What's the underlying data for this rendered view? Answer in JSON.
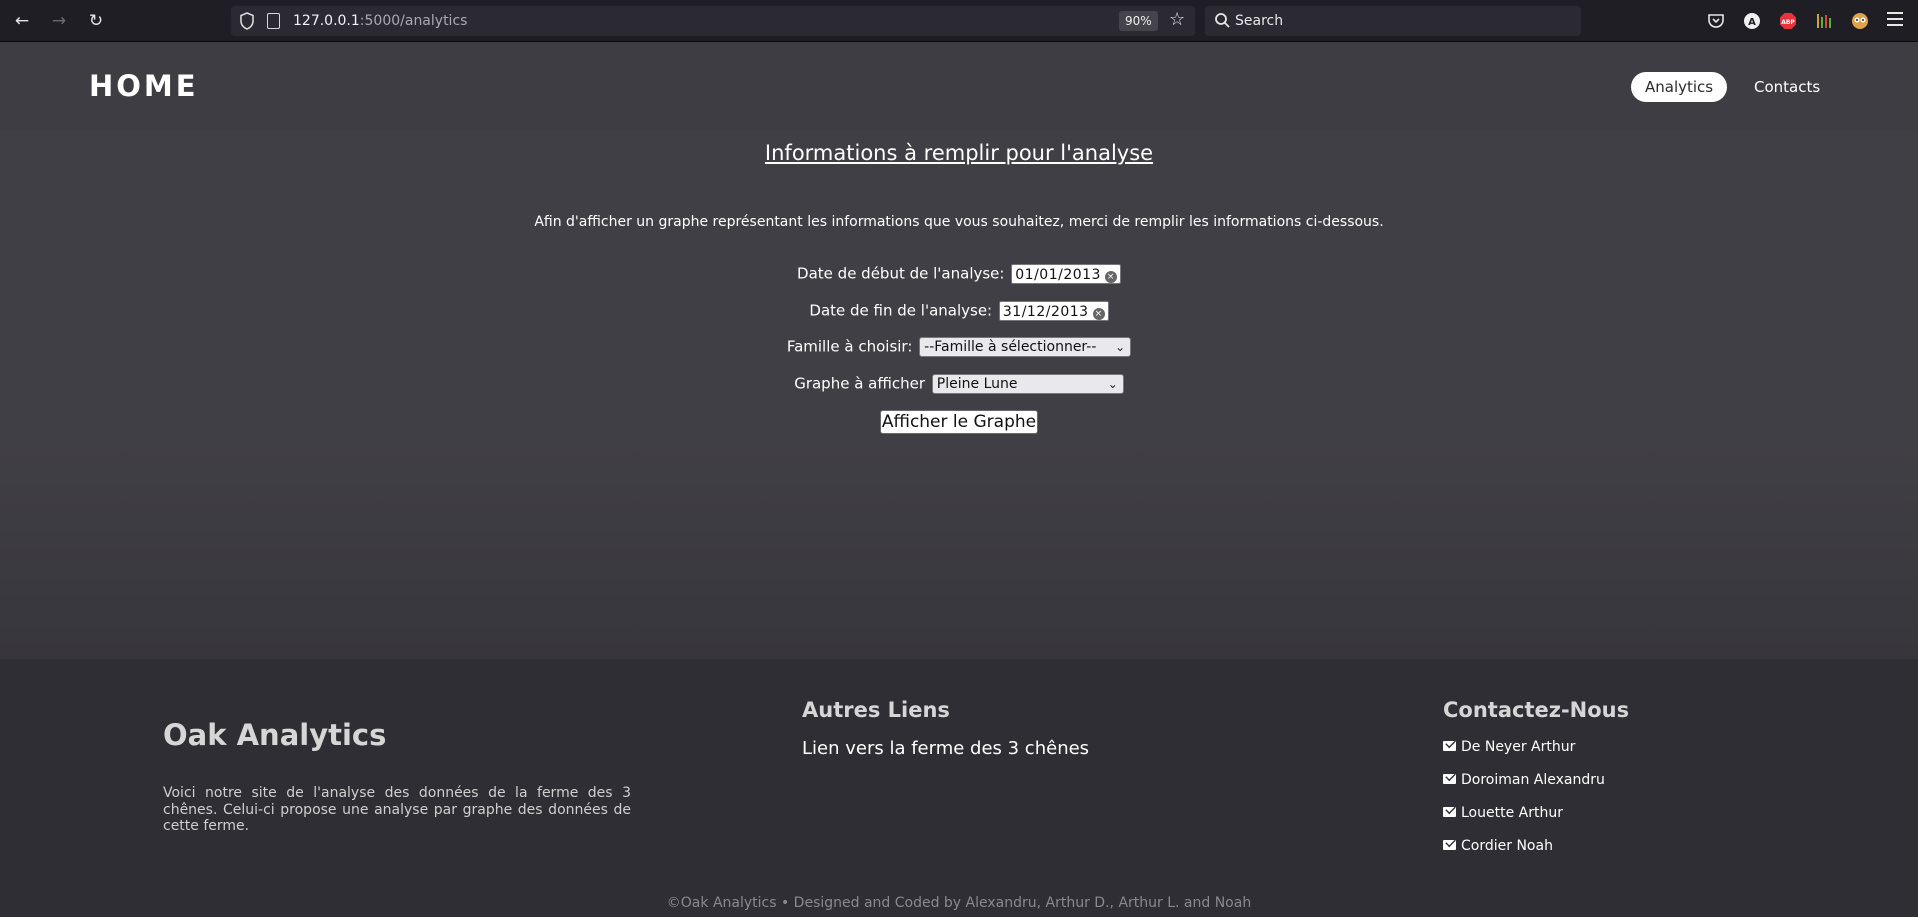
{
  "browser": {
    "url_host": "127.0.0.1",
    "url_path": ":5000/analytics",
    "zoom": "90%",
    "search_placeholder": "Search"
  },
  "nav": {
    "brand": "HOME",
    "links": [
      {
        "label": "Analytics",
        "active": true
      },
      {
        "label": "Contacts",
        "active": false
      }
    ]
  },
  "main": {
    "title": "Informations à remplir pour l'analyse",
    "intro": "Afin d'afficher un graphe représentant les informations que vous souhaitez, merci de remplir les informations ci-dessous.",
    "start_label": "Date de début de l'analyse:",
    "start_value": "01/01/2013",
    "end_label": "Date de fin de l'analyse:",
    "end_value": "31/12/2013",
    "family_label": "Famille à choisir:",
    "family_value": "--Famille à sélectionner--",
    "graph_label": "Graphe à afficher",
    "graph_value": "Pleine Lune",
    "submit_label": "Afficher le Graphe"
  },
  "footer": {
    "brand": "Oak Analytics",
    "description": "Voici notre site de l'analyse des données de la ferme des 3 chênes. Celui-ci propose une analyse par graphe des données de cette ferme.",
    "links_heading": "Autres Liens",
    "links": [
      "Lien vers la ferme des 3 chênes"
    ],
    "contact_heading": "Contactez-Nous",
    "contacts": [
      "De Neyer Arthur",
      "Doroiman Alexandru",
      "Louette Arthur",
      "Cordier Noah"
    ],
    "copyright": "©Oak Analytics • Designed and Coded by Alexandru, Arthur D., Arthur L. and Noah"
  }
}
